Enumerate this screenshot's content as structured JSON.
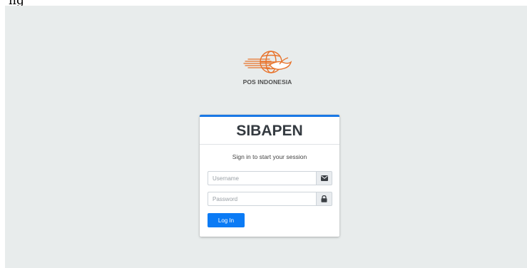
{
  "top_text": "ng",
  "logo": {
    "text": "POS INDONESIA",
    "color": "#e8722a"
  },
  "card": {
    "title": "SIBAPEN",
    "subtitle": "Sign in to start your session",
    "accent": "#1978e5"
  },
  "form": {
    "username": {
      "placeholder": "Username",
      "value": "",
      "icon": "envelope-icon"
    },
    "password": {
      "placeholder": "Password",
      "value": "",
      "icon": "lock-icon"
    },
    "submit_label": "Log In",
    "submit_color": "#0b7bf5"
  }
}
